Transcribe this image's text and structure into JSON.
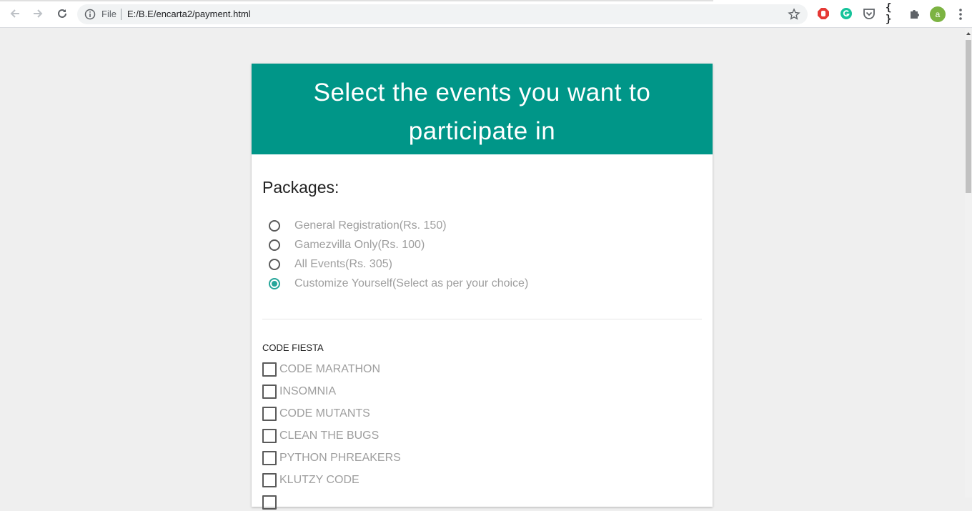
{
  "browser": {
    "scheme_label": "File",
    "url": "E:/B.E/encarta2/payment.html",
    "profile_initial": "a",
    "extensions": [
      "adblock-icon",
      "grammarly-icon",
      "pocket-icon",
      "json-viewer-icon",
      "puzzle-icon"
    ],
    "json_ext_label": "{ }"
  },
  "card": {
    "title": "Select the events you want to participate in",
    "packages_title": "Packages:",
    "packages": [
      {
        "label": "General Registration(Rs. 150)",
        "checked": false
      },
      {
        "label": "Gamezvilla Only(Rs. 100)",
        "checked": false
      },
      {
        "label": "All Events(Rs. 305)",
        "checked": false
      },
      {
        "label": "Customize Yourself(Select as per your choice)",
        "checked": true
      }
    ],
    "group_title": "CODE FIESTA",
    "events": [
      {
        "label": "CODE MARATHON",
        "checked": false
      },
      {
        "label": "INSOMNIA",
        "checked": false
      },
      {
        "label": "CODE MUTANTS",
        "checked": false
      },
      {
        "label": "CLEAN THE BUGS",
        "checked": false
      },
      {
        "label": "PYTHON PHREAKERS",
        "checked": false
      },
      {
        "label": "KLUTZY CODE",
        "checked": false
      }
    ]
  },
  "colors": {
    "header": "#009688",
    "radio_accent": "#26a69a",
    "page_bg": "#efefef"
  }
}
